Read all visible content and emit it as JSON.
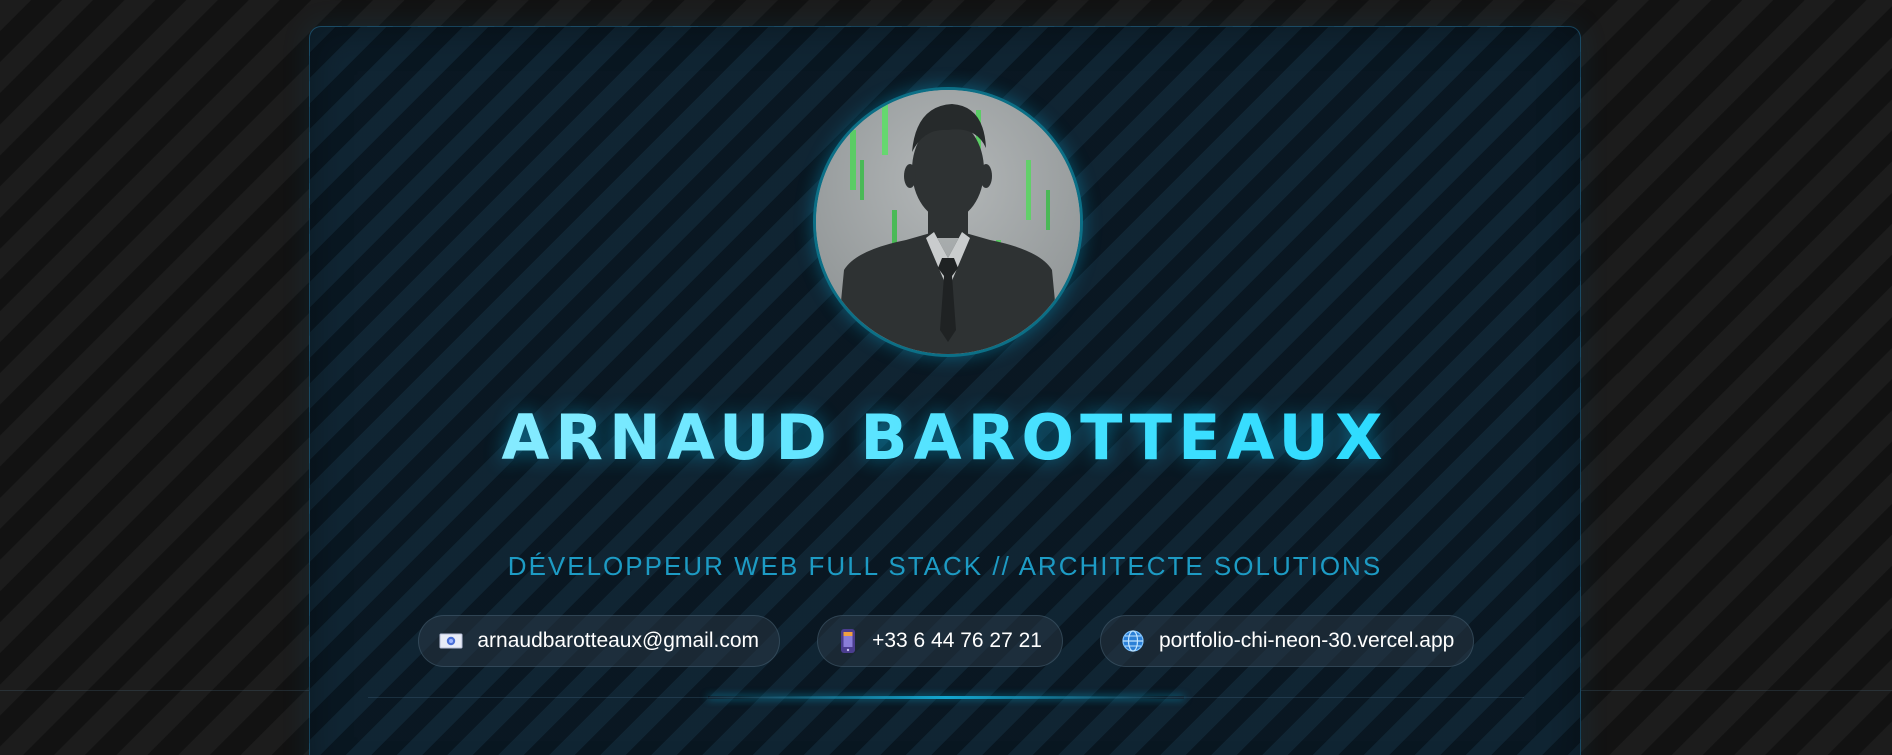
{
  "profile": {
    "name": "ARNAUD BAROTTEAUX",
    "title": "DÉVELOPPEUR WEB FULL STACK // ARCHITECTE SOLUTIONS"
  },
  "contacts": {
    "email": "arnaudbarotteaux@gmail.com",
    "phone": "+33 6 44 76 27 21",
    "website": "portfolio-chi-neon-30.vercel.app"
  },
  "icons": {
    "email": "envelope-icon",
    "phone": "mobile-phone-icon",
    "website": "globe-icon"
  },
  "colors": {
    "accent": "#44e0ff",
    "subtitle": "#1d9bc4",
    "card_background": "#0b1a26",
    "page_background": "#141414"
  }
}
